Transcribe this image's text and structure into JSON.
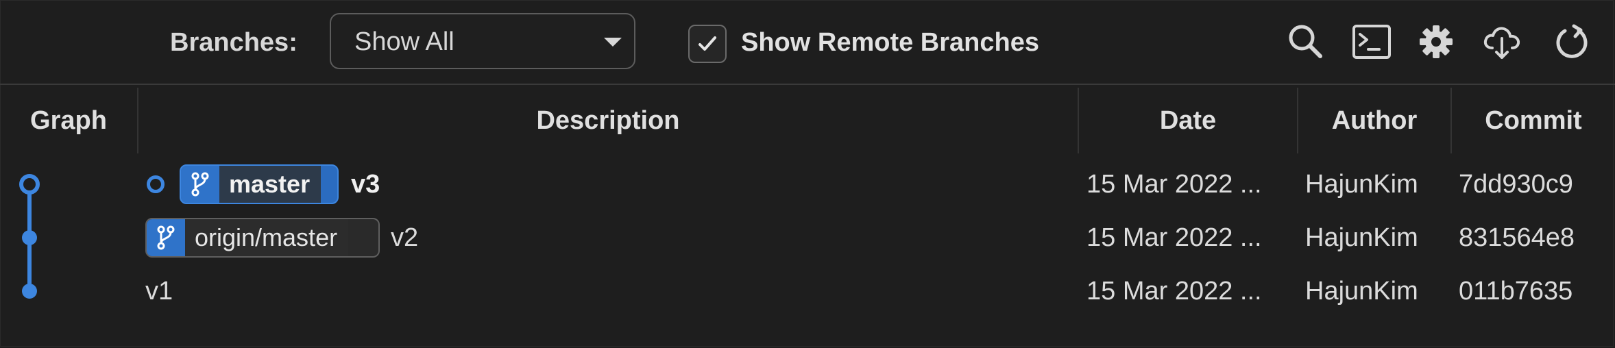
{
  "toolbar": {
    "branches_label": "Branches:",
    "branches_select_value": "Show All",
    "show_remote_checked": true,
    "show_remote_label": "Show Remote Branches",
    "icons": [
      "search-icon",
      "terminal-icon",
      "gear-icon",
      "cloud-download-icon",
      "refresh-icon"
    ]
  },
  "columns": {
    "graph": "Graph",
    "description": "Description",
    "date": "Date",
    "author": "Author",
    "commit": "Commit"
  },
  "commits": [
    {
      "is_head": true,
      "branch": "master",
      "branch_kind": "local",
      "message": "v3",
      "date": "15 Mar 2022 ...",
      "author": "HajunKim",
      "hash": "7dd930c9"
    },
    {
      "is_head": false,
      "branch": "origin/master",
      "branch_kind": "remote",
      "message": "v2",
      "date": "15 Mar 2022 ...",
      "author": "HajunKim",
      "hash": "831564e8"
    },
    {
      "is_head": false,
      "branch": "",
      "branch_kind": "",
      "message": "v1",
      "date": "15 Mar 2022 ...",
      "author": "HajunKim",
      "hash": "011b7635"
    }
  ],
  "colors": {
    "accent": "#3d86e0",
    "background": "#1e1e1e",
    "text": "#dcdcdc"
  }
}
